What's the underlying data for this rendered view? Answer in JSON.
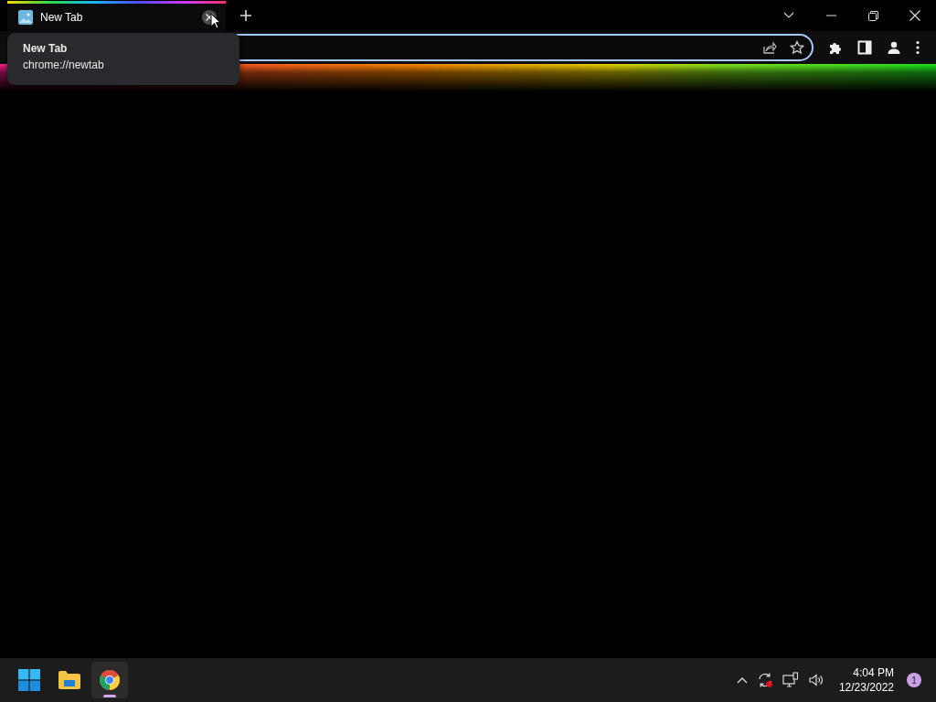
{
  "tabs": [
    {
      "title": "New Tab",
      "selected": true
    }
  ],
  "tooltip": {
    "title": "New Tab",
    "url": "chrome://newtab"
  },
  "taskbar": {
    "apps": [
      {
        "kind": "start",
        "selected": false
      },
      {
        "kind": "explorer",
        "selected": false
      },
      {
        "kind": "chrome",
        "selected": true
      }
    ],
    "clock": {
      "time": "4:04 PM",
      "date": "12/23/2022"
    },
    "notification_count": "1"
  }
}
